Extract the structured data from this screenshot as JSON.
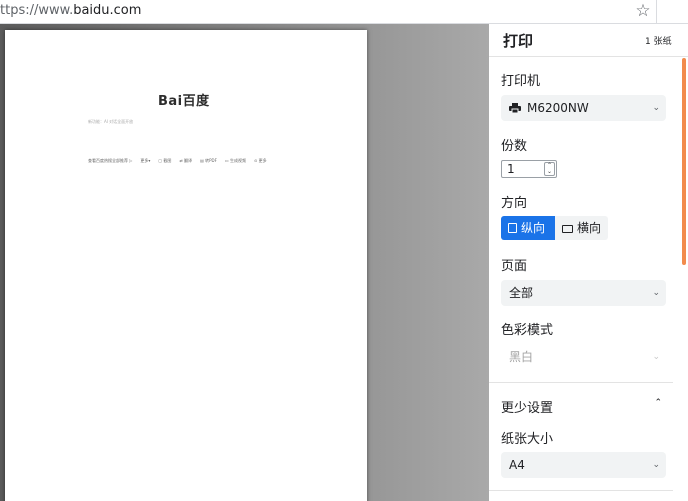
{
  "urlbar": {
    "scheme": "ttps://www.",
    "host": "baidu.com",
    "star_icon": "star-icon"
  },
  "preview": {
    "logo_text": "Bai百度",
    "tagline": "新功能：AI 对话全面开放",
    "hot_items": [
      "查看百度热搜全部推荐 ▷",
      "更多▾",
      "▢ 截图",
      "⇄ 翻译",
      "▤ 转PDF",
      "▭ 生成视频",
      "⊙ 更多"
    ]
  },
  "panel": {
    "title": "打印",
    "sheet_count": "1 张纸",
    "printer_label": "打印机",
    "printer_value": "M6200NW",
    "copies_label": "份数",
    "copies_value": "1",
    "orientation_label": "方向",
    "portrait_label": "纵向",
    "landscape_label": "横向",
    "pages_label": "页面",
    "pages_value": "全部",
    "color_label": "色彩模式",
    "color_value": "黑白",
    "more_settings_label": "更少设置",
    "paper_size_label": "纸张大小",
    "paper_size_value": "A4"
  },
  "colors": {
    "accent": "#1a73e8",
    "scrollbar": "#f28b4c"
  }
}
